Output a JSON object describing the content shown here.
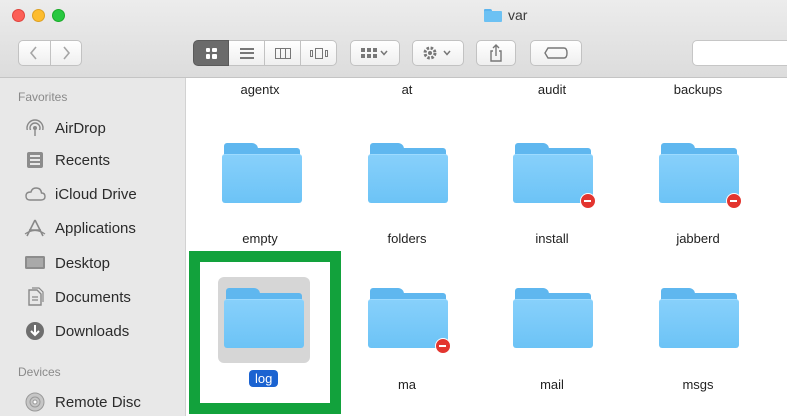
{
  "window": {
    "title": "var"
  },
  "toolbar": {
    "back_icon": "chevron-left-icon",
    "forward_icon": "chevron-right-icon",
    "views": [
      "icon-view-icon",
      "list-view-icon",
      "column-view-icon",
      "gallery-view-icon"
    ],
    "group_icon": "group-by-icon",
    "action_icon": "gear-icon",
    "share_icon": "share-icon",
    "tag_icon": "tag-icon"
  },
  "sidebar": {
    "favorites_heading": "Favorites",
    "favorites": [
      {
        "label": "AirDrop",
        "icon": "airdrop-icon"
      },
      {
        "label": "Recents",
        "icon": "recents-icon"
      },
      {
        "label": "iCloud Drive",
        "icon": "cloud-icon"
      },
      {
        "label": "Applications",
        "icon": "applications-icon"
      },
      {
        "label": "Desktop",
        "icon": "desktop-icon"
      },
      {
        "label": "Documents",
        "icon": "documents-icon"
      },
      {
        "label": "Downloads",
        "icon": "downloads-icon"
      }
    ],
    "devices_heading": "Devices",
    "devices": [
      {
        "label": "Remote Disc",
        "icon": "disc-icon"
      }
    ]
  },
  "files": {
    "row0": [
      "agentx",
      "at",
      "audit",
      "backups"
    ],
    "row1": [
      {
        "name": "empty",
        "restricted": false
      },
      {
        "name": "folders",
        "restricted": false
      },
      {
        "name": "install",
        "restricted": true
      },
      {
        "name": "jabberd",
        "restricted": true
      }
    ],
    "row2": [
      {
        "name": "log",
        "restricted": false,
        "selected": true
      },
      {
        "name": "ma",
        "restricted": true
      },
      {
        "name": "mail",
        "restricted": false
      },
      {
        "name": "msgs",
        "restricted": false
      }
    ]
  },
  "colors": {
    "selection": "#1b63d1",
    "highlight_box": "#12a23c",
    "folder": "#6cc3f6"
  }
}
